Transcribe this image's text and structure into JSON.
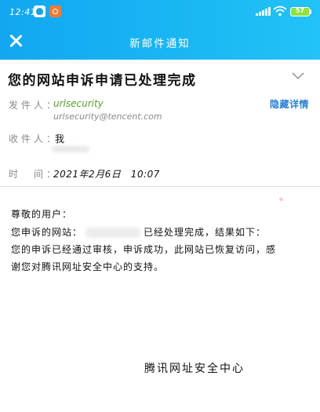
{
  "status_bar": {
    "time": "12:41",
    "battery_label": "57",
    "icons": [
      "qq-notification-icon",
      "app-notification-icon",
      "signal-icon",
      "wifi-icon",
      "battery-icon"
    ]
  },
  "header": {
    "title": "新邮件通知",
    "close_icon": "close-icon",
    "background_colors": [
      "#12a7f0",
      "#22c3f6"
    ]
  },
  "email": {
    "subject": "您的网站申诉申请已处理完成",
    "collapse_icon": "chevron-down-icon",
    "sender_label": "发件人：",
    "sender_name": "urlsecurity",
    "sender_email": "urlsecurity@tencent.com",
    "hide_details": "隐藏详情",
    "recipient_label": "收件人：",
    "recipient": "我",
    "time_label": "时　间：",
    "time": "2021年2月6日　10:07",
    "body": {
      "greeting": "尊敬的用户：",
      "line1_prefix": "您申诉的网站：",
      "line1_suffix": "已经处理完成，结果如下：",
      "line2": "您的申诉已经通过审核，申诉成功，此网站已恢复访问，感",
      "line3": "谢您对腾讯网址安全中心的支持。"
    },
    "signature": "腾讯网址安全中心"
  },
  "colors": {
    "sender_name": "#58a12a",
    "link": "#2d7fd6",
    "label": "#8a8a8a"
  }
}
